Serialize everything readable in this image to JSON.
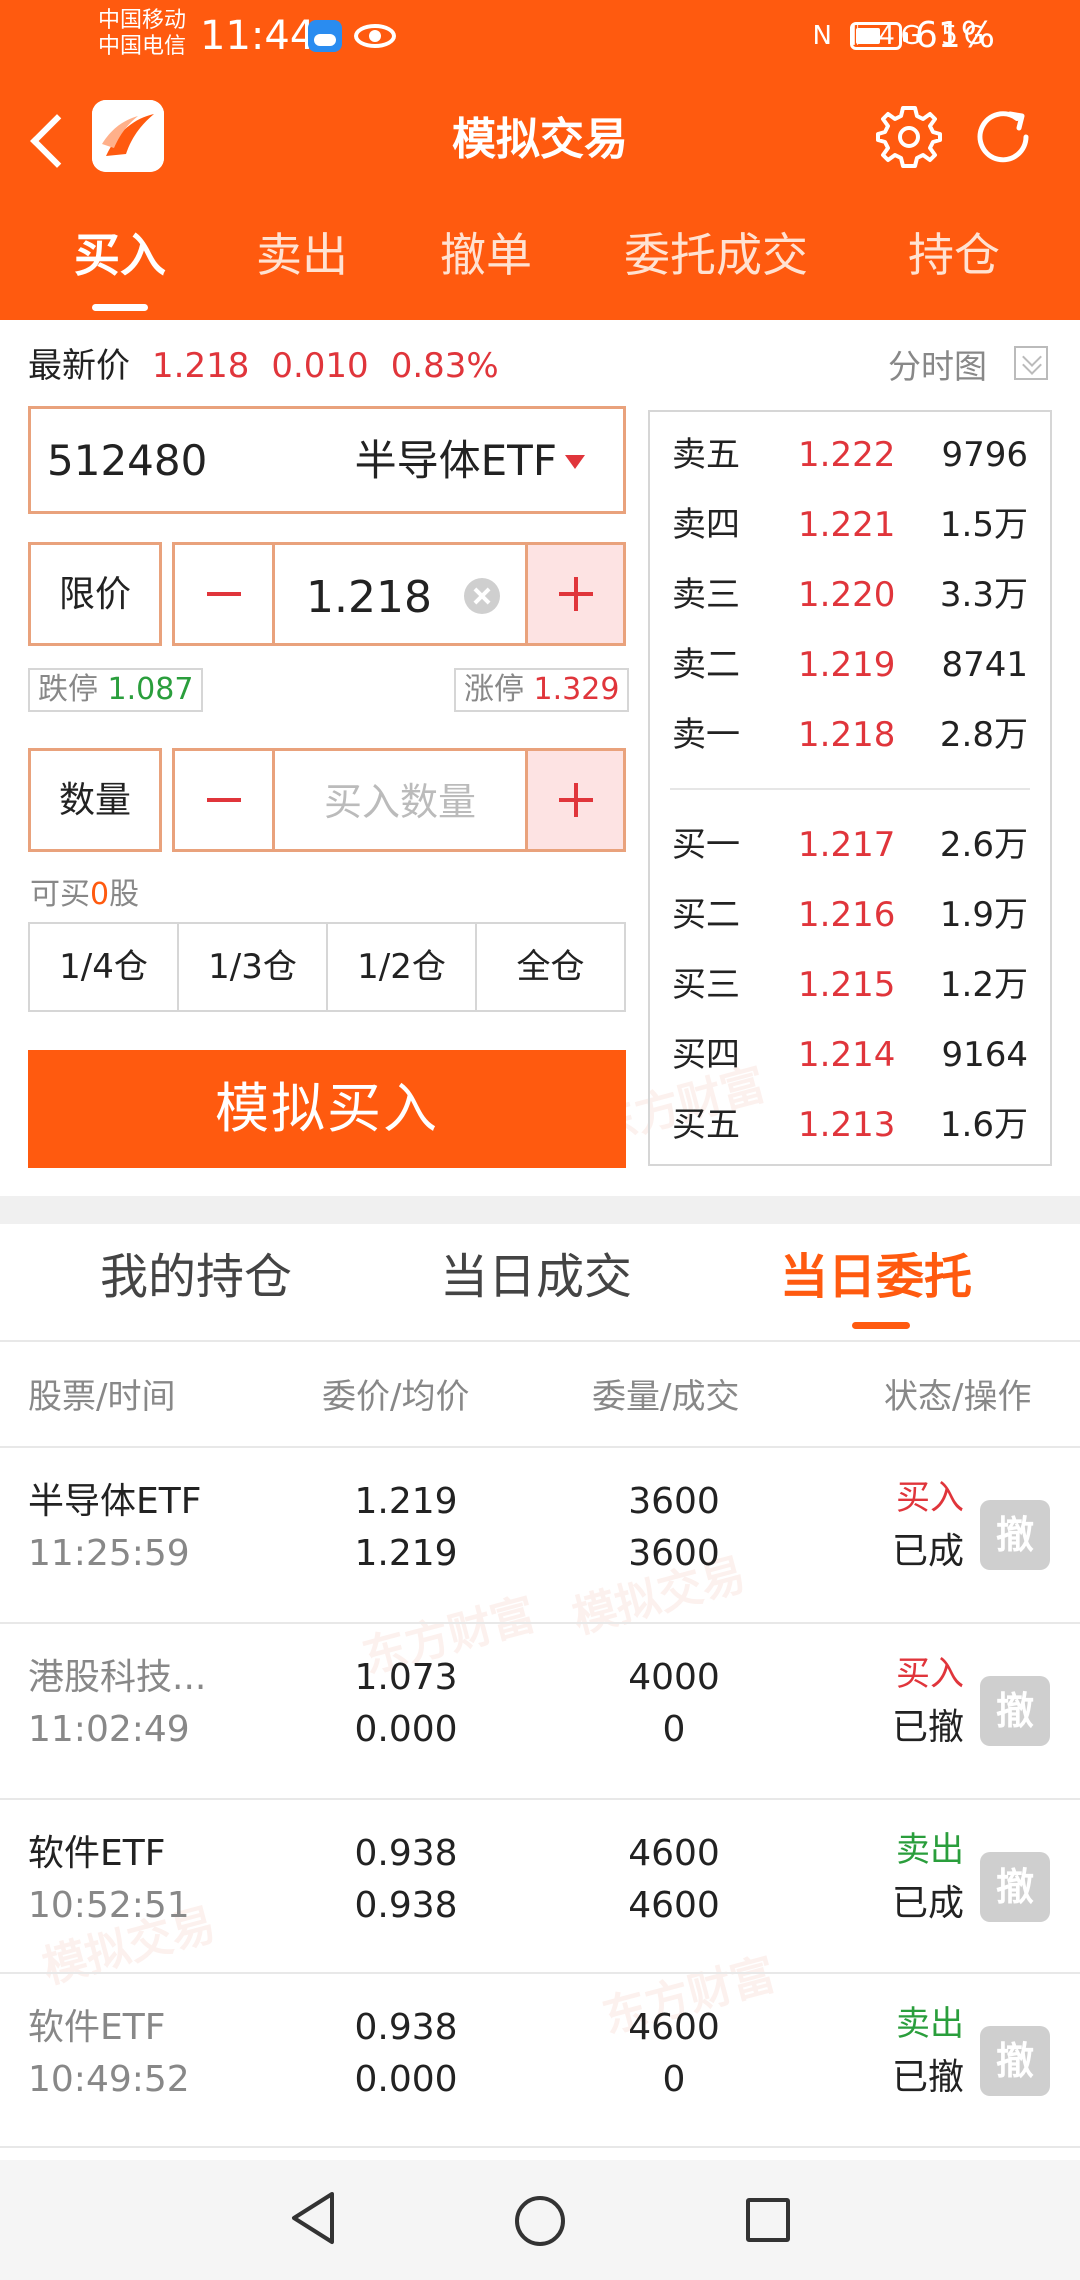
{
  "status_bar": {
    "carrier_1": "中国移动",
    "carrier_2": "中国电信",
    "time": "11:44",
    "network": "N 𝄃 4G 5G",
    "battery_percent": 61,
    "battery_text": "61%"
  },
  "header": {
    "title": "模拟交易",
    "tabs": [
      "买入",
      "卖出",
      "撤单",
      "委托成交",
      "持仓"
    ],
    "active_tab": 0
  },
  "quote": {
    "label": "最新价",
    "price": "1.218",
    "change": "0.010",
    "change_pct": "0.83%",
    "chart_link": "分时图"
  },
  "stock": {
    "code": "512480",
    "name": "半导体ETF"
  },
  "price_input": {
    "type_label": "限价",
    "value": "1.218",
    "minus": "−",
    "plus": "+"
  },
  "limits": {
    "down_label": "跌停",
    "down_value": "1.087",
    "up_label": "涨停",
    "up_value": "1.329"
  },
  "quantity_input": {
    "label": "数量",
    "placeholder": "买入数量"
  },
  "can_buy": {
    "prefix": "可买",
    "count": "0",
    "suffix": "股"
  },
  "ratios": [
    "1/4仓",
    "1/3仓",
    "1/2仓",
    "全仓"
  ],
  "buy_button": "模拟买入",
  "order_book": {
    "asks": [
      {
        "name": "卖五",
        "price": "1.222",
        "volume": "9796"
      },
      {
        "name": "卖四",
        "price": "1.221",
        "volume": "1.5万"
      },
      {
        "name": "卖三",
        "price": "1.220",
        "volume": "3.3万"
      },
      {
        "name": "卖二",
        "price": "1.219",
        "volume": "8741"
      },
      {
        "name": "卖一",
        "price": "1.218",
        "volume": "2.8万"
      }
    ],
    "bids": [
      {
        "name": "买一",
        "price": "1.217",
        "volume": "2.6万"
      },
      {
        "name": "买二",
        "price": "1.216",
        "volume": "1.9万"
      },
      {
        "name": "买三",
        "price": "1.215",
        "volume": "1.2万"
      },
      {
        "name": "买四",
        "price": "1.214",
        "volume": "9164"
      },
      {
        "name": "买五",
        "price": "1.213",
        "volume": "1.6万"
      }
    ]
  },
  "list_tabs": [
    "我的持仓",
    "当日成交",
    "当日委托"
  ],
  "list_active_tab": 2,
  "columns": [
    "股票/时间",
    "委价/均价",
    "委量/成交",
    "状态/操作"
  ],
  "orders": [
    {
      "name": "半导体ETF",
      "time": "11:25:59",
      "order_price": "1.219",
      "avg_price": "1.219",
      "order_qty": "3600",
      "filled_qty": "3600",
      "side": "买入",
      "side_type": "buy",
      "status": "已成",
      "cancel": "撤"
    },
    {
      "name": "港股科技...",
      "time": "11:02:49",
      "order_price": "1.073",
      "avg_price": "0.000",
      "order_qty": "4000",
      "filled_qty": "0",
      "side": "买入",
      "side_type": "buy",
      "status": "已撤",
      "cancel": "撤"
    },
    {
      "name": "软件ETF",
      "time": "10:52:51",
      "order_price": "0.938",
      "avg_price": "0.938",
      "order_qty": "4600",
      "filled_qty": "4600",
      "side": "卖出",
      "side_type": "sell",
      "status": "已成",
      "cancel": "撤"
    },
    {
      "name": "软件ETF",
      "time": "10:49:52",
      "order_price": "0.938",
      "avg_price": "0.000",
      "order_qty": "4600",
      "filled_qty": "0",
      "side": "卖出",
      "side_type": "sell",
      "status": "已撤",
      "cancel": "撤"
    }
  ],
  "watermark": {
    "brand": "东方财富",
    "mode": "模拟交易"
  },
  "colors": {
    "brand": "#ff5a0f",
    "up": "#e0353b",
    "down": "#2a9e3c"
  }
}
